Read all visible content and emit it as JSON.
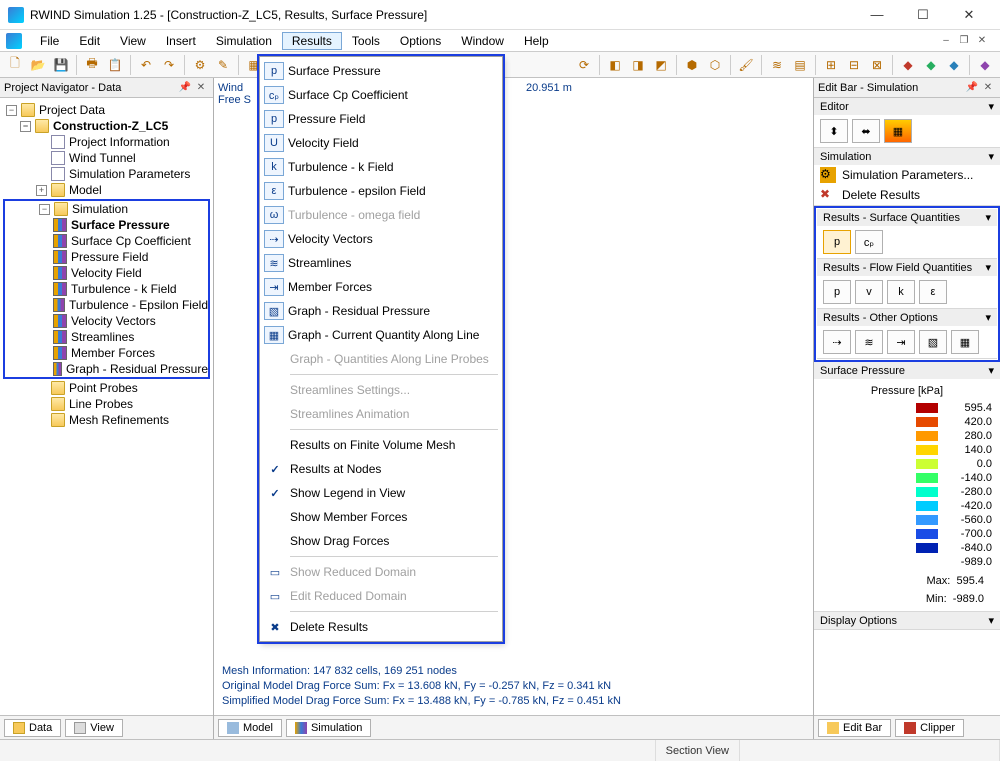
{
  "title": "RWIND Simulation 1.25 - [Construction-Z_LC5, Results, Surface Pressure]",
  "menu": {
    "file": "File",
    "edit": "Edit",
    "view": "View",
    "insert": "Insert",
    "simulation": "Simulation",
    "results": "Results",
    "tools": "Tools",
    "options": "Options",
    "window": "Window",
    "help": "Help"
  },
  "nav": {
    "title": "Project Navigator - Data",
    "root": "Project Data",
    "project": "Construction-Z_LC5",
    "items1": [
      "Project Information",
      "Wind Tunnel",
      "Simulation Parameters",
      "Model",
      "Simulation"
    ],
    "simChildren": [
      "Surface Pressure",
      "Surface Cp Coefficient",
      "Pressure Field",
      "Velocity Field",
      "Turbulence - k Field",
      "Turbulence - Epsilon Field",
      "Velocity Vectors",
      "Streamlines",
      "Member Forces",
      "Graph - Residual Pressure"
    ],
    "after": [
      "Point Probes",
      "Line Probes",
      "Mesh Refinements"
    ],
    "tabs": {
      "data": "Data",
      "view": "View"
    }
  },
  "viewport": {
    "l1": "Wind",
    "l2": "Free S",
    "dim": "20.951 m",
    "mesh": "Mesh Information: 147 832 cells, 169 251 nodes",
    "drag1": "Original Model Drag Force Sum: Fx = 13.608 kN, Fy = -0.257 kN, Fz = 0.341 kN",
    "drag2": "Simplified Model Drag Force Sum: Fx = 13.488 kN, Fy = -0.785 kN, Fz = 0.451 kN",
    "tabs": {
      "model": "Model",
      "sim": "Simulation"
    }
  },
  "dropdown": {
    "items": [
      {
        "ico": "p",
        "label": "Surface Pressure",
        "box": true
      },
      {
        "ico": "cₚ",
        "label": "Surface Cp Coefficient",
        "box": true
      },
      {
        "ico": "p",
        "label": "Pressure Field",
        "box": true
      },
      {
        "ico": "U",
        "label": "Velocity Field",
        "box": true
      },
      {
        "ico": "k",
        "label": "Turbulence - k Field",
        "box": true
      },
      {
        "ico": "ε",
        "label": "Turbulence - epsilon Field",
        "box": true
      },
      {
        "ico": "ω",
        "label": "Turbulence - omega field",
        "box": true,
        "disabled": true
      },
      {
        "ico": "⇢",
        "label": "Velocity Vectors",
        "box": true
      },
      {
        "ico": "≋",
        "label": "Streamlines",
        "box": true
      },
      {
        "ico": "⇥",
        "label": "Member Forces",
        "box": true
      },
      {
        "ico": "▧",
        "label": "Graph - Residual Pressure",
        "box": true
      },
      {
        "ico": "▦",
        "label": "Graph - Current Quantity Along Line",
        "box": true
      },
      {
        "ico": "",
        "label": "Graph - Quantities Along Line Probes",
        "disabled": true
      }
    ],
    "items2": [
      {
        "label": "Streamlines Settings...",
        "disabled": true
      },
      {
        "label": "Streamlines Animation",
        "disabled": true
      }
    ],
    "items3": [
      {
        "label": "Results on Finite Volume Mesh"
      },
      {
        "label": "Results at Nodes",
        "chk": true
      },
      {
        "label": "Show Legend in View",
        "chk": true
      },
      {
        "label": "Show Member Forces"
      },
      {
        "label": "Show Drag Forces"
      }
    ],
    "items4": [
      {
        "ico": "▭",
        "label": "Show Reduced Domain",
        "disabled": true
      },
      {
        "ico": "▭",
        "label": "Edit Reduced Domain",
        "disabled": true
      }
    ],
    "items5": [
      {
        "ico": "✖",
        "label": "Delete Results"
      }
    ]
  },
  "right": {
    "title": "Edit Bar - Simulation",
    "editor": "Editor",
    "sim": "Simulation",
    "simParams": "Simulation Parameters...",
    "delRes": "Delete Results",
    "surfQ": "Results - Surface Quantities",
    "flowQ": "Results - Flow Field Quantities",
    "otherQ": "Results - Other Options",
    "surfPressure": "Surface Pressure",
    "legendTitle": "Pressure [kPa]",
    "legend": [
      {
        "c": "#b30000",
        "v": "595.4"
      },
      {
        "c": "#e64a00",
        "v": "420.0"
      },
      {
        "c": "#ff9900",
        "v": "280.0"
      },
      {
        "c": "#ffd500",
        "v": "140.0"
      },
      {
        "c": "#ccff33",
        "v": "0.0"
      },
      {
        "c": "#33ff66",
        "v": "-140.0"
      },
      {
        "c": "#00ffcc",
        "v": "-280.0"
      },
      {
        "c": "#00ccff",
        "v": "-420.0"
      },
      {
        "c": "#3399ff",
        "v": "-560.0"
      },
      {
        "c": "#1a4de6",
        "v": "-700.0"
      },
      {
        "c": "#0022b3",
        "v": "-840.0"
      },
      {
        "c": "",
        "v": "-989.0"
      }
    ],
    "max": "Max:",
    "maxv": "595.4",
    "min": "Min:",
    "minv": "-989.0",
    "disp": "Display Options",
    "tabs": {
      "editbar": "Edit Bar",
      "clipper": "Clipper"
    }
  },
  "status": {
    "section": "Section View"
  }
}
